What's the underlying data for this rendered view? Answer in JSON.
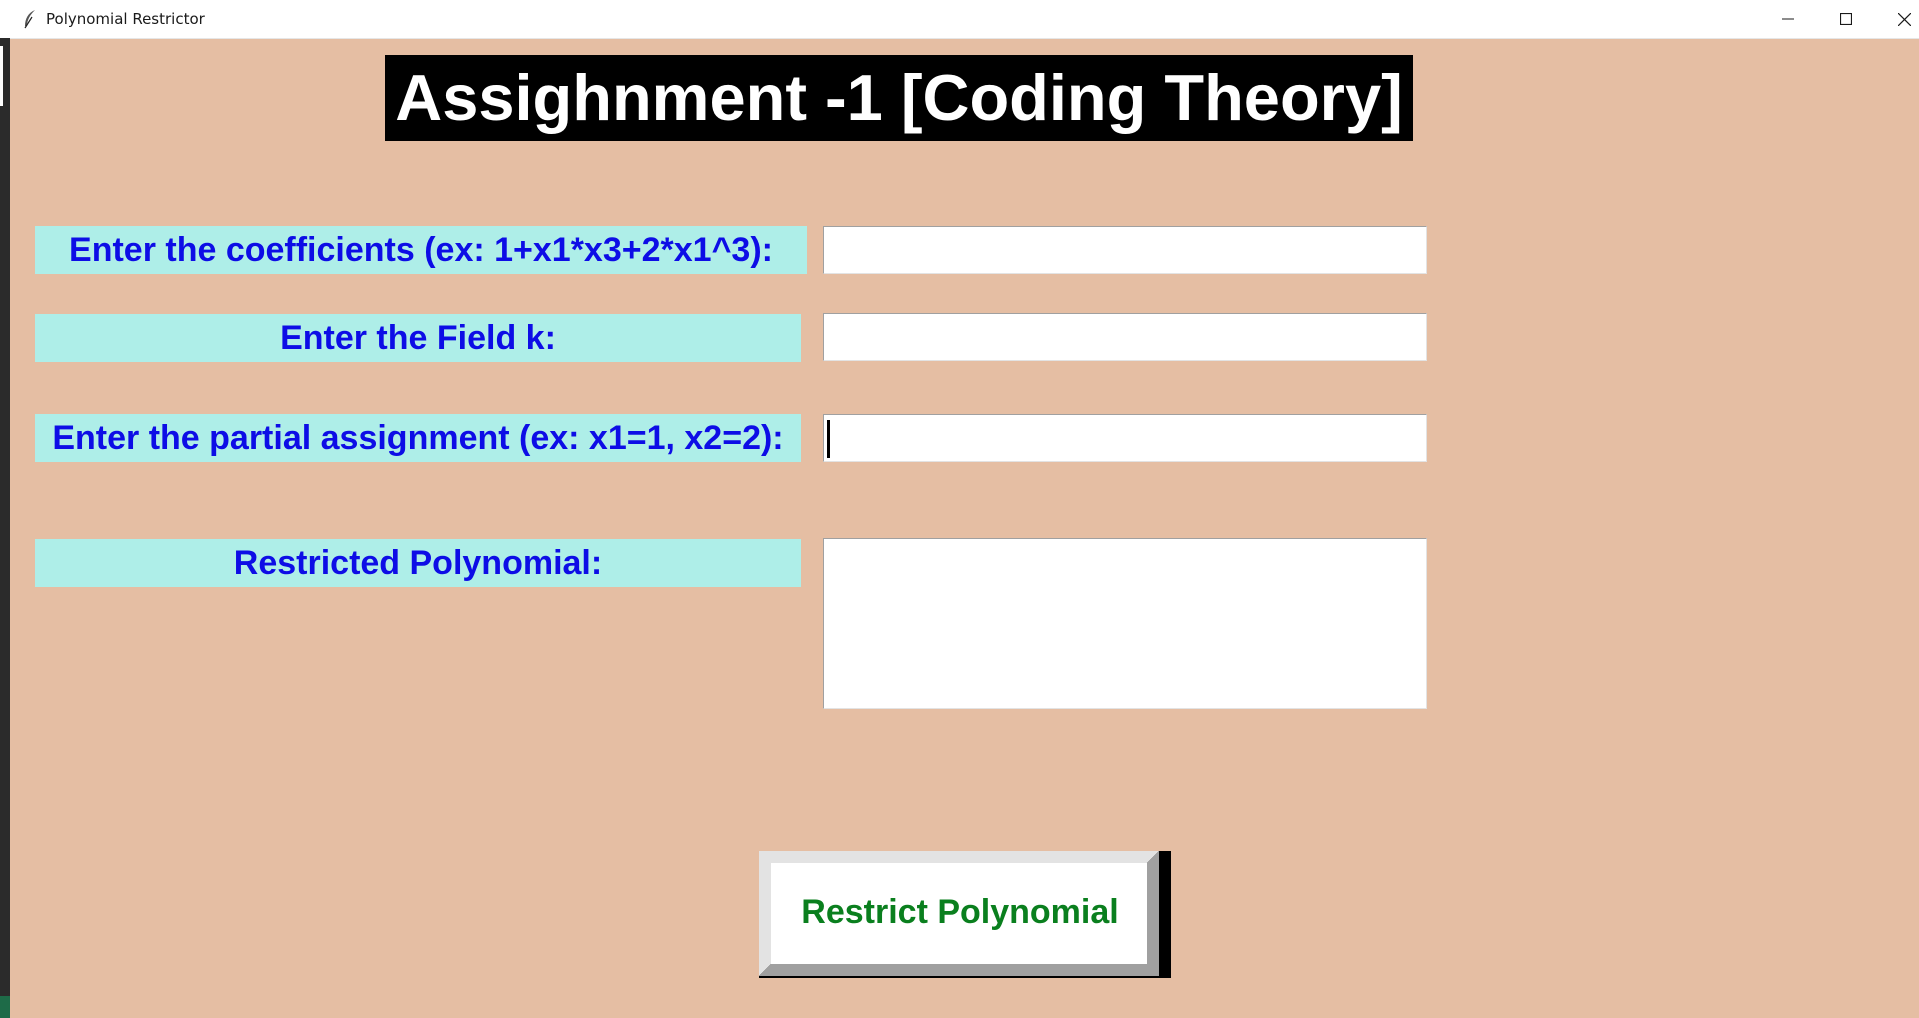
{
  "window": {
    "title": "Polynomial Restrictor",
    "background_color": "#e5bea3"
  },
  "heading": {
    "text": "Assighnment -1 [Coding Theory]"
  },
  "form": {
    "coefficients_label": "Enter the coefficients (ex: 1+x1*x3+2*x1^3):",
    "coefficients_value": "",
    "field_label": "Enter the Field k:",
    "field_value": "",
    "assignment_label": "Enter the partial assignment (ex: x1=1, x2=2):",
    "assignment_value": "",
    "result_label": "Restricted Polynomial:",
    "result_value": ""
  },
  "actions": {
    "restrict_label": "Restrict Polynomial"
  },
  "colors": {
    "label_bg": "#aeeee8",
    "label_text": "#0d0de6",
    "button_text": "#0a7f1e",
    "heading_bg": "#000000"
  },
  "icons": {
    "app": "feather-icon",
    "minimize": "minimize-icon",
    "maximize": "maximize-icon",
    "close": "close-icon"
  }
}
